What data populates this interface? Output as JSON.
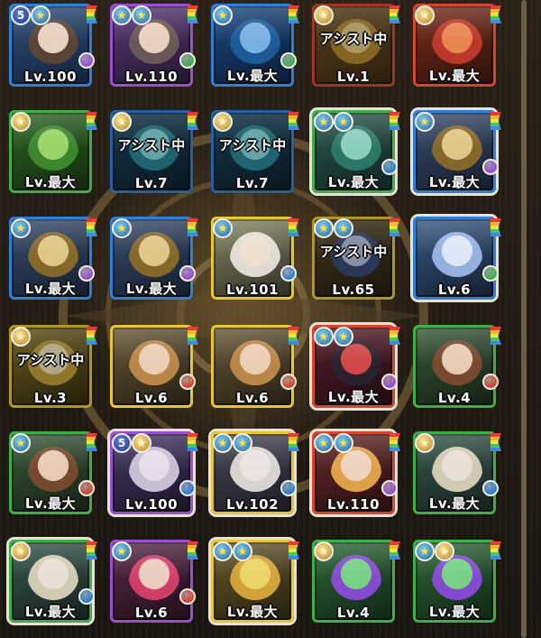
{
  "colors": {
    "water": "#2f7fd6",
    "fire": "#d8452f",
    "wood": "#3fae4a",
    "light": "#e6c634",
    "dark": "#9a4fd0"
  },
  "box": {
    "rows": [
      {
        "cards": [
          {
            "name": "dark-swordswoman",
            "att": "water",
            "sub": "dark",
            "level": "Lv.100",
            "badges": [
              "awakening-5",
              "star"
            ],
            "assist": false,
            "selected": false,
            "skin": "#f1d8c4",
            "hair": "#5b4436",
            "c1": "#2e4e7a",
            "c2": "#12233b"
          },
          {
            "name": "dark-swordswoman-2",
            "att": "dark",
            "sub": "wood",
            "level": "Lv.110",
            "badges": [
              "star",
              "star"
            ],
            "assist": false,
            "selected": false,
            "skin": "#f1d8c4",
            "hair": "#6a5a56",
            "c1": "#5b3a7a",
            "c2": "#22162f"
          },
          {
            "name": "blue-seed-pod",
            "att": "water",
            "sub": "wood",
            "level": "Lv.最大",
            "badges": [
              "star"
            ],
            "assist": false,
            "selected": false,
            "skin": "#7fb6e8",
            "hair": "#1d5d9a",
            "c1": "#1d4b85",
            "c2": "#0b1a33"
          },
          {
            "name": "golden-orb",
            "att": "fire",
            "sub": "",
            "level": "Lv.1",
            "badges": [
              "gold-star"
            ],
            "assist": true,
            "assist_label": "アシスト中",
            "selected": false,
            "skin": "#e8cf88",
            "hair": "#b58b2e",
            "c1": "#7a5a26",
            "c2": "#3a2812"
          },
          {
            "name": "red-seed-pod",
            "att": "fire",
            "sub": "",
            "level": "Lv.最大",
            "badges": [
              "gold-star"
            ],
            "assist": false,
            "selected": false,
            "skin": "#f08a52",
            "hair": "#c0392b",
            "c1": "#7a2e1a",
            "c2": "#2e110b"
          }
        ]
      },
      {
        "cards": [
          {
            "name": "green-weapon",
            "att": "wood",
            "sub": "",
            "level": "Lv.最大",
            "badges": [
              "gold-star"
            ],
            "assist": false,
            "selected": false,
            "skin": "#9edc6a",
            "hair": "#3d8a2e",
            "c1": "#2e6a24",
            "c2": "#12280d"
          },
          {
            "name": "cyan-blade-a",
            "att": "water",
            "sub": "",
            "level": "Lv.7",
            "badges": [
              "gold-star"
            ],
            "assist": true,
            "assist_label": "アシスト中",
            "selected": false,
            "skin": "#89e3e6",
            "hair": "#2a8a96",
            "c1": "#1d4e6a",
            "c2": "#0c1d28"
          },
          {
            "name": "cyan-blade-b",
            "att": "water",
            "sub": "",
            "level": "Lv.7",
            "badges": [
              "gold-star"
            ],
            "assist": true,
            "assist_label": "アシスト中",
            "selected": false,
            "skin": "#89e3e6",
            "hair": "#2a8a96",
            "c1": "#1d4e6a",
            "c2": "#0c1d28"
          },
          {
            "name": "cyan-armor",
            "att": "wood",
            "sub": "water",
            "level": "Lv.最大",
            "badges": [
              "star",
              "star"
            ],
            "assist": false,
            "selected": true,
            "skin": "#8fd6c2",
            "hair": "#2e7a6a",
            "c1": "#2a5a4e",
            "c2": "#0f2420"
          },
          {
            "name": "golden-gauntlet",
            "att": "water",
            "sub": "dark",
            "level": "Lv.最大",
            "badges": [
              "star"
            ],
            "assist": false,
            "selected": true,
            "skin": "#e8cf88",
            "hair": "#8a6a2a",
            "c1": "#3a4e6e",
            "c2": "#141d2c"
          }
        ]
      },
      {
        "cards": [
          {
            "name": "golden-gauntlet-2",
            "att": "water",
            "sub": "dark",
            "level": "Lv.最大",
            "badges": [
              "star"
            ],
            "assist": false,
            "selected": false,
            "skin": "#e8cf88",
            "hair": "#8a6a2a",
            "c1": "#3a4e6e",
            "c2": "#141d2c"
          },
          {
            "name": "golden-gauntlet-3",
            "att": "water",
            "sub": "dark",
            "level": "Lv.最大",
            "badges": [
              "star"
            ],
            "assist": false,
            "selected": false,
            "skin": "#e8cf88",
            "hair": "#8a6a2a",
            "c1": "#3a4e6e",
            "c2": "#141d2c"
          },
          {
            "name": "white-haired-girl",
            "att": "light",
            "sub": "water",
            "level": "Lv.101",
            "badges": [
              "star"
            ],
            "assist": false,
            "selected": false,
            "skin": "#f6e6d6",
            "hair": "#e6e2da",
            "c1": "#8a8a6a",
            "c2": "#2e2e22"
          },
          {
            "name": "gold-armor-assist",
            "att": "light",
            "sub": "",
            "level": "Lv.65",
            "badges": [
              "star",
              "star"
            ],
            "assist": true,
            "assist_label": "アシスト中",
            "selected": false,
            "skin": "#b8c6e0",
            "hair": "#3a4a7a",
            "c1": "#5a4a2a",
            "c2": "#221a0e"
          },
          {
            "name": "ice-queen",
            "att": "water",
            "sub": "wood",
            "level": "Lv.6",
            "badges": [],
            "assist": false,
            "selected": true,
            "skin": "#e6f0ff",
            "hair": "#9ab6e6",
            "c1": "#3a5a86",
            "c2": "#141f30"
          }
        ]
      },
      {
        "cards": [
          {
            "name": "light-scroll",
            "att": "light",
            "sub": "",
            "level": "Lv.3",
            "badges": [
              "gold-star"
            ],
            "assist": true,
            "assist_label": "アシスト中",
            "selected": false,
            "skin": "#f3e8b8",
            "hair": "#c4a23a",
            "c1": "#8a7a2a",
            "c2": "#33290d"
          },
          {
            "name": "blond-boy-a",
            "att": "light",
            "sub": "fire",
            "level": "Lv.6",
            "badges": [],
            "assist": false,
            "selected": false,
            "skin": "#f3d6bc",
            "hair": "#c08a4a",
            "c1": "#6a5a3a",
            "c2": "#251e12"
          },
          {
            "name": "blond-boy-b",
            "att": "light",
            "sub": "fire",
            "level": "Lv.6",
            "badges": [],
            "assist": false,
            "selected": false,
            "skin": "#f3d6bc",
            "hair": "#c08a4a",
            "c1": "#6a5a3a",
            "c2": "#251e12"
          },
          {
            "name": "masked-girl",
            "att": "fire",
            "sub": "dark",
            "level": "Lv.最大",
            "badges": [
              "star",
              "star"
            ],
            "assist": false,
            "selected": true,
            "skin": "#d84a4a",
            "hair": "#2a2230",
            "c1": "#5a1e2a",
            "c2": "#1e0b10"
          },
          {
            "name": "brown-hair-elf",
            "att": "wood",
            "sub": "fire",
            "level": "Lv.4",
            "badges": [],
            "assist": false,
            "selected": false,
            "skin": "#f1d2ba",
            "hair": "#7a4a2e",
            "c1": "#3a5a3a",
            "c2": "#142014"
          }
        ]
      },
      {
        "cards": [
          {
            "name": "brown-hair-elf-2",
            "att": "wood",
            "sub": "fire",
            "level": "Lv.最大",
            "badges": [
              "star"
            ],
            "assist": false,
            "selected": false,
            "skin": "#f1d2ba",
            "hair": "#7a4a2e",
            "c1": "#3a5a3a",
            "c2": "#142014"
          },
          {
            "name": "white-dark-girl",
            "att": "dark",
            "sub": "water",
            "level": "Lv.100",
            "badges": [
              "awakening-5",
              "gold-star"
            ],
            "assist": false,
            "selected": true,
            "skin": "#efe6f0",
            "hair": "#cfc6da",
            "c1": "#4a3a6a",
            "c2": "#1a1426"
          },
          {
            "name": "silver-maid",
            "att": "light",
            "sub": "water",
            "level": "Lv.102",
            "badges": [
              "star",
              "star"
            ],
            "assist": false,
            "selected": true,
            "skin": "#f3ecea",
            "hair": "#e0dcd6",
            "c1": "#4a4a5a",
            "c2": "#1a1a22"
          },
          {
            "name": "blonde-vampire",
            "att": "fire",
            "sub": "dark",
            "level": "Lv.110",
            "badges": [
              "star",
              "star"
            ],
            "assist": false,
            "selected": true,
            "skin": "#f6dcc6",
            "hair": "#e6a84a",
            "c1": "#6a2a2a",
            "c2": "#260e0e"
          },
          {
            "name": "white-crowned-girl",
            "att": "wood",
            "sub": "water",
            "level": "Lv.最大",
            "badges": [
              "gold-star"
            ],
            "assist": false,
            "selected": false,
            "skin": "#f3e6dc",
            "hair": "#d8d2b8",
            "c1": "#3a5a4e",
            "c2": "#14201c"
          }
        ]
      },
      {
        "cards": [
          {
            "name": "white-crowned-girl-2",
            "att": "wood",
            "sub": "water",
            "level": "Lv.最大",
            "badges": [
              "gold-star"
            ],
            "assist": false,
            "selected": true,
            "skin": "#f3e6dc",
            "hair": "#d8d2b8",
            "c1": "#3a5a4e",
            "c2": "#14201c"
          },
          {
            "name": "pink-hair-girl",
            "att": "dark",
            "sub": "fire",
            "level": "Lv.6",
            "badges": [
              "star"
            ],
            "assist": false,
            "selected": false,
            "skin": "#f3d6c6",
            "hair": "#d8406a",
            "c1": "#5a2a4a",
            "c2": "#200e1a"
          },
          {
            "name": "yellow-dog",
            "att": "light",
            "sub": "",
            "level": "Lv.最大",
            "badges": [
              "star",
              "star"
            ],
            "assist": false,
            "selected": true,
            "skin": "#f3dc6a",
            "hair": "#d8a83a",
            "c1": "#6a5a2a",
            "c2": "#262010"
          },
          {
            "name": "green-dragon-a",
            "att": "wood",
            "sub": "",
            "level": "Lv.4",
            "badges": [
              "gold-star"
            ],
            "assist": false,
            "selected": false,
            "skin": "#7ad88a",
            "hair": "#8a4ad8",
            "c1": "#2e6a3a",
            "c2": "#102614"
          },
          {
            "name": "green-dragon-b",
            "att": "wood",
            "sub": "",
            "level": "Lv.最大",
            "badges": [
              "star",
              "gold-star"
            ],
            "assist": false,
            "selected": false,
            "skin": "#7ad88a",
            "hair": "#8a4ad8",
            "c1": "#2e6a3a",
            "c2": "#102614"
          }
        ]
      }
    ]
  }
}
